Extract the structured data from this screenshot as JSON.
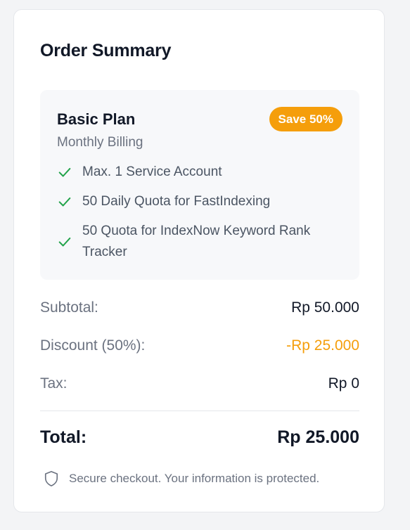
{
  "order": {
    "title": "Order Summary",
    "plan": {
      "name": "Basic Plan",
      "billing": "Monthly Billing",
      "badge": "Save 50%",
      "features": [
        "Max. 1 Service Account",
        "50 Daily Quota for FastIndexing",
        "50 Quota for IndexNow Keyword Rank Tracker"
      ]
    },
    "subtotal": {
      "label": "Subtotal:",
      "value": "Rp 50.000"
    },
    "discount": {
      "label": "Discount (50%):",
      "value": "-Rp 25.000"
    },
    "tax": {
      "label": "Tax:",
      "value": "Rp 0"
    },
    "total": {
      "label": "Total:",
      "value": "Rp 25.000"
    },
    "secure_note": "Secure checkout. Your information is protected."
  },
  "icons": {
    "check": "check-icon",
    "shield": "shield-icon"
  },
  "colors": {
    "accent": "#f59e0b",
    "check": "#22a34a",
    "muted_text": "#6b7280",
    "plan_bg": "#f7f8fa"
  }
}
